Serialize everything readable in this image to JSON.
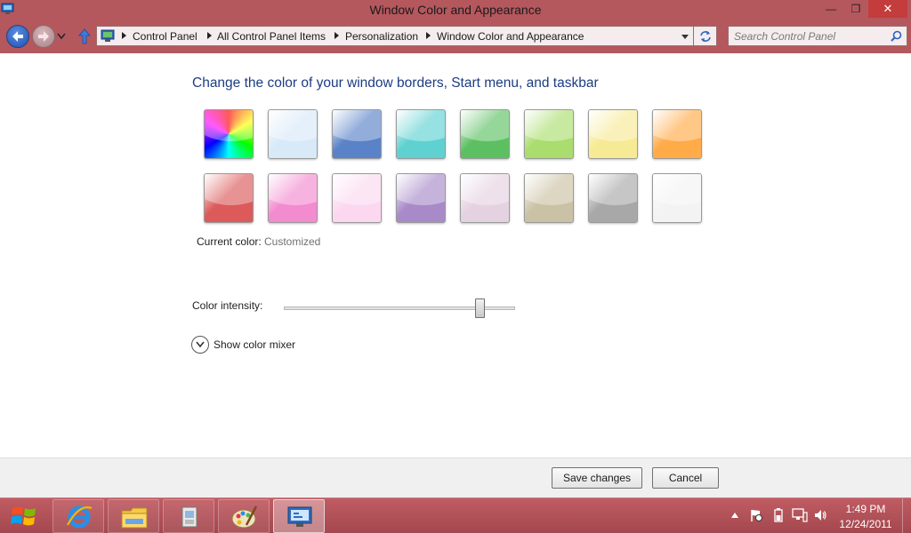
{
  "window": {
    "title": "Window Color and Appearance",
    "minimize": "—",
    "restore": "❐",
    "close": "✕"
  },
  "breadcrumb": {
    "items": [
      "Control Panel",
      "All Control Panel Items",
      "Personalization",
      "Window Color and Appearance"
    ]
  },
  "search": {
    "placeholder": "Search Control Panel"
  },
  "main": {
    "heading": "Change the color of your window borders, Start menu, and taskbar",
    "swatches": [
      {
        "name": "rainbow",
        "color": "#ff00ff"
      },
      {
        "name": "sky",
        "color": "#d8e9f8"
      },
      {
        "name": "twilight",
        "color": "#5a82c8"
      },
      {
        "name": "sea",
        "color": "#5fd1d1"
      },
      {
        "name": "leaf",
        "color": "#5cc063"
      },
      {
        "name": "lime",
        "color": "#a9dd6d"
      },
      {
        "name": "lemon",
        "color": "#f7ea95"
      },
      {
        "name": "pumpkin",
        "color": "#ffab48"
      },
      {
        "name": "ruby",
        "color": "#dc5a5a"
      },
      {
        "name": "fuchsia",
        "color": "#f38bcf"
      },
      {
        "name": "blush",
        "color": "#fbd8ef"
      },
      {
        "name": "violet",
        "color": "#a88ac9"
      },
      {
        "name": "lavender",
        "color": "#e5d2e1"
      },
      {
        "name": "taupe",
        "color": "#cbc1a4"
      },
      {
        "name": "chocolate",
        "color": "#a8a8a8"
      },
      {
        "name": "frost",
        "color": "#f3f3f3"
      }
    ],
    "current_color_label": "Current color:",
    "current_color_value": "Customized",
    "intensity_label": "Color intensity:",
    "intensity_value": 0.85,
    "mixer_label": "Show color mixer"
  },
  "footer": {
    "save_label": "Save changes",
    "cancel_label": "Cancel"
  },
  "taskbar": {
    "items": [
      "internet-explorer-icon",
      "file-explorer-icon",
      "program-icon",
      "paint-icon",
      "control-panel-icon"
    ],
    "clock_time": "1:49 PM",
    "clock_date": "12/24/2011"
  },
  "colors": {
    "chrome": "#b4585e",
    "heading": "#1c3d82",
    "taskbar": "#b0525a"
  }
}
